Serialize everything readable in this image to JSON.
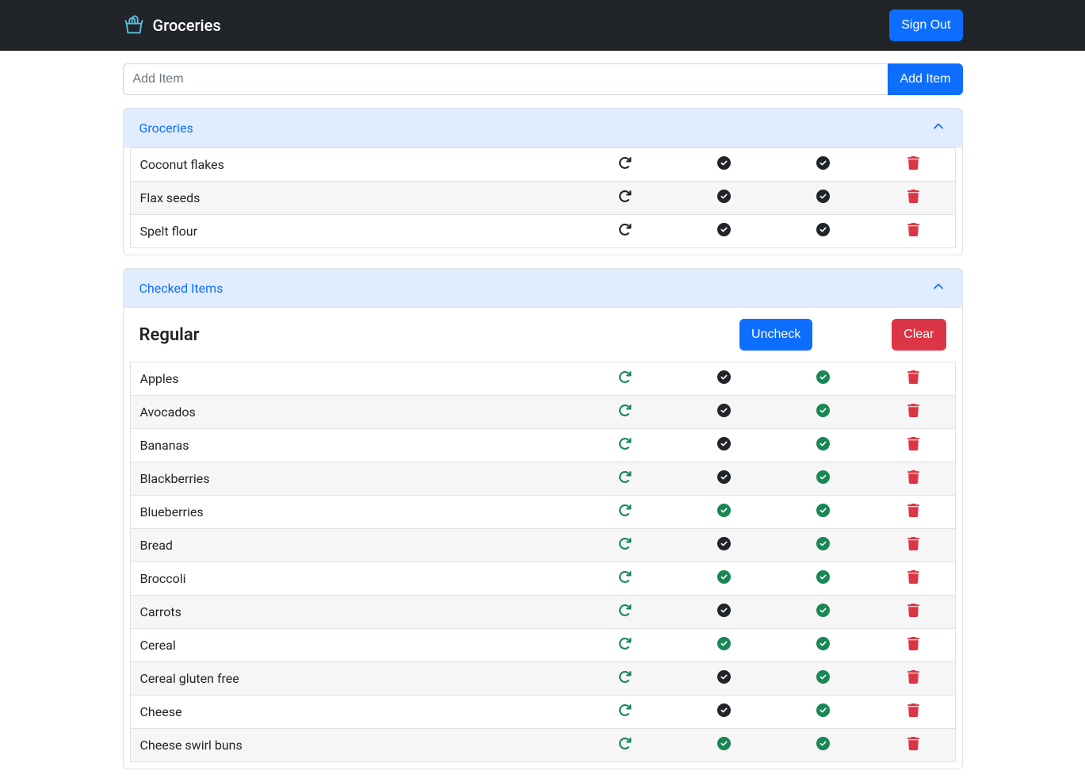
{
  "brand": "Groceries",
  "signout_label": "Sign Out",
  "add_input_placeholder": "Add Item",
  "add_button_label": "Add Item",
  "groceries_header": "Groceries",
  "checked_header": "Checked Items",
  "regular_title": "Regular",
  "uncheck_label": "Uncheck",
  "clear_label": "Clear",
  "active_items": [
    {
      "name": "Coconut flakes",
      "redo": "black",
      "c1": "black",
      "c2": "black"
    },
    {
      "name": "Flax seeds",
      "redo": "black",
      "c1": "black",
      "c2": "black"
    },
    {
      "name": "Spelt flour",
      "redo": "black",
      "c1": "black",
      "c2": "black"
    }
  ],
  "checked_items": [
    {
      "name": "Apples",
      "redo": "green",
      "c1": "black",
      "c2": "green"
    },
    {
      "name": "Avocados",
      "redo": "green",
      "c1": "black",
      "c2": "green"
    },
    {
      "name": "Bananas",
      "redo": "green",
      "c1": "black",
      "c2": "green"
    },
    {
      "name": "Blackberries",
      "redo": "green",
      "c1": "black",
      "c2": "green"
    },
    {
      "name": "Blueberries",
      "redo": "green",
      "c1": "green",
      "c2": "green"
    },
    {
      "name": "Bread",
      "redo": "green",
      "c1": "black",
      "c2": "green"
    },
    {
      "name": "Broccoli",
      "redo": "green",
      "c1": "green",
      "c2": "green"
    },
    {
      "name": "Carrots",
      "redo": "green",
      "c1": "black",
      "c2": "green"
    },
    {
      "name": "Cereal",
      "redo": "green",
      "c1": "green",
      "c2": "green"
    },
    {
      "name": "Cereal gluten free",
      "redo": "green",
      "c1": "black",
      "c2": "green"
    },
    {
      "name": "Cheese",
      "redo": "green",
      "c1": "black",
      "c2": "green"
    },
    {
      "name": "Cheese swirl buns",
      "redo": "green",
      "c1": "green",
      "c2": "green"
    }
  ]
}
